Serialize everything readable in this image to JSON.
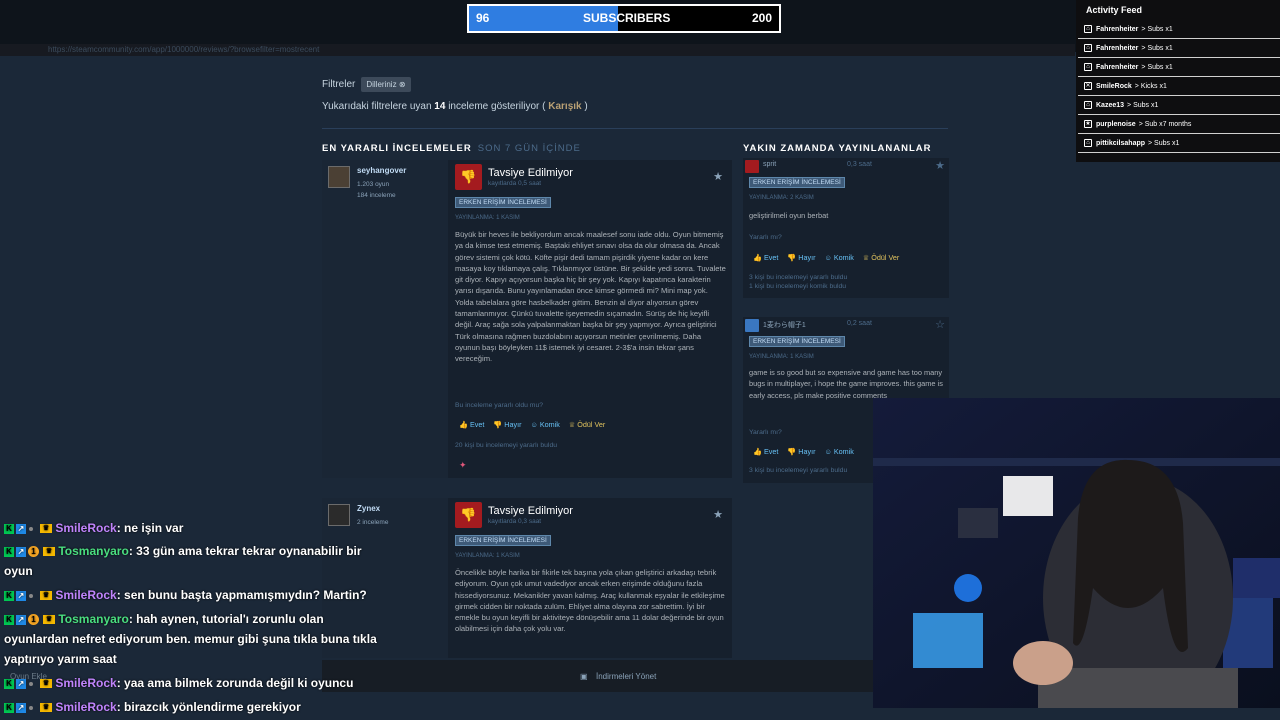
{
  "browser": {
    "url": "https://steamcommunity.com/app/1000000/reviews/?browsefilter=mostrecent"
  },
  "subscriber_bar": {
    "current": "96",
    "label": "SUBSCRIBERS",
    "goal": "200",
    "progress": 0.48
  },
  "activity_feed": {
    "title": "Activity Feed",
    "items": [
      {
        "user": "Fahrenheiter",
        "action": "> Subs x1",
        "icon": "sub-icon"
      },
      {
        "user": "Fahrenheiter",
        "action": "> Subs x1",
        "icon": "sub-icon"
      },
      {
        "user": "Fahrenheiter",
        "action": "> Subs x1",
        "icon": "sub-icon"
      },
      {
        "user": "SmileRock",
        "action": "> Kicks x1",
        "icon": "kick-icon"
      },
      {
        "user": "Kazee13",
        "action": "> Subs x1",
        "icon": "sub-icon"
      },
      {
        "user": "purplenoise",
        "action": "> Sub x7 months",
        "icon": "star-icon"
      },
      {
        "user": "pittikcilsahapp",
        "action": "> Subs x1",
        "icon": "sub-icon"
      }
    ]
  },
  "filters": {
    "label": "Filtreler",
    "chip": "Dilleriniz",
    "summary_prefix": "Yukarıdaki filtrelere uyan",
    "summary_count": "14",
    "summary_suffix": "inceleme gösteriliyor (",
    "summary_mixed": "Karışık",
    "summary_close": ")"
  },
  "sections": {
    "most_helpful": "EN YARARLI İNCELEMELER",
    "period": "SON 7 GÜN İÇİNDE",
    "recent": "YAKIN ZAMANDA YAYINLANANLAR"
  },
  "reviews": [
    {
      "user": "seyhangover",
      "games": "1.203 oyun",
      "reviews_count": "184 inceleme",
      "verdict": "Tavsiye Edilmiyor",
      "playtime": "kayıtlarda 0,5 saat",
      "badge": "ERKEN ERİŞİM İNCELEMESİ",
      "posted": "YAYINLANMA: 1 KASIM",
      "text": "Büyük bir heves ile bekliyordum ancak maalesef sonu iade oldu. Oyun bitmemiş ya da kimse test etmemiş. Baştaki ehliyet sınavı olsa da olur olmasa da. Ancak görev sistemi çok kötü. Köfte pişir dedi tamam pişirdik yiyene kadar on kere masaya koy tıklamaya çalış. Tıklanmıyor üstüne. Bir şekilde yedi sonra. Tuvalete git diyor. Kapıyı açıyorsun başka hiç bir şey yok. Kapıyı kapatınca karakterin yarısı dışarıda. Bunu yayınlamadan önce kimse görmedi mi? Mini map yok. Yolda tabelalara göre hasbelkader gittim. Benzin al diyor alıyorsun görev tamamlanmıyor. Çünkü tuvalette işeyemedin sıçamadın. Sürüş de hiç keyifli değil. Araç sağa sola yalpalanmaktan başka bir şey yapmıyor. Ayrıca geliştirici Türk olmasına rağmen buzdolabını açıyorsun metinler çevrilmemiş. Daha oyunun başı böyleyken 11$ istemek iyi cesaret. 2-3$'a insin tekrar şans vereceğim.",
      "helpful_q": "Bu inceleme yararlı oldu mu?",
      "yes": "Evet",
      "no": "Hayır",
      "funny": "Komik",
      "award": "Ödül Ver",
      "helpful_count": "20 kişi bu incelemeyi yararlı buldu"
    },
    {
      "user": "Zynex",
      "games": "",
      "reviews_count": "2 inceleme",
      "verdict": "Tavsiye Edilmiyor",
      "playtime": "kayıtlarda 0,3 saat",
      "badge": "ERKEN ERİŞİM İNCELEMESİ",
      "posted": "YAYINLANMA: 1 KASIM",
      "text": "Öncelikle böyle harika bir fikirle tek başına yola çıkan geliştirici arkadaşı tebrik ediyorum. Oyun çok umut vadediyor ancak erken erişimde olduğunu fazla hissediyorsunuz. Mekanikler yavan kalmış. Araç kullanmak eşyalar ile etkileşime girmek cidden bir noktada zulüm. Ehliyet alma olayına zor sabrettim. İyi bir emekle bu oyun keyifli bir aktiviteye dönüşebilir ama 11 dolar değerinde bir oyun olabilmesi için daha çok yolu var."
    }
  ],
  "recent": [
    {
      "user": "sprit",
      "time": "0,3 saat",
      "badge": "ERKEN ERİŞİM İNCELEMESİ",
      "posted": "YAYINLANMA: 2 KASIM",
      "text": "geliştirilmeli oyun berbat",
      "helpful_q": "Yararlı mı?",
      "yes": "Evet",
      "no": "Hayır",
      "funny": "Komik",
      "award": "Ödül Ver",
      "helpful_count": "3 kişi bu incelemeyi yararlı buldu",
      "funny_count": "1 kişi bu incelemeyi komik buldu",
      "color": "#a41b1f"
    },
    {
      "user": "1麦わら帽子1",
      "time": "0,2 saat",
      "badge": "ERKEN ERİŞİM İNCELEMESİ",
      "posted": "YAYINLANMA: 1 KASIM",
      "text": "game is so good but so expensive and game has too many bugs in multiplayer, i hope the game improves. this game is early access, pls make positive comments",
      "helpful_q": "Yararlı mı?",
      "yes": "Evet",
      "no": "Hayır",
      "funny": "Komik",
      "helpful_count": "3 kişi bu incelemeyi yararlı buldu",
      "color": "#3a77c0"
    }
  ],
  "bottom": {
    "manage_downloads": "İndirmeleri Yönet",
    "games_list": "Oyun Ekle"
  },
  "chat": [
    {
      "user": "SmileRock",
      "msg": ": ne işin var",
      "color": "purple",
      "badges": "kb-c"
    },
    {
      "user": "Tosmanyaro",
      "msg": ": 33 gün ama tekrar tekrar oynanabilir bir",
      "cont": "oyun",
      "color": "green",
      "badges": "kb1c"
    },
    {
      "user": "SmileRock",
      "msg": ": sen bunu başta yapmamışmıydın? Martin?",
      "color": "purple",
      "badges": "kb-c"
    },
    {
      "user": "Tosmanyaro",
      "msg": ": hah aynen, tutorial'ı zorunlu olan",
      "cont": "oyunlardan nefret ediyorum ben. memur gibi şuna tıkla buna tıkla",
      "cont2": "yaptırıyo yarım saat",
      "color": "green",
      "badges": "kb1c"
    },
    {
      "user": "SmileRock",
      "msg": ": yaa ama bilmek zorunda değil ki oyuncu",
      "color": "purple",
      "badges": "kb-c"
    },
    {
      "user": "SmileRock",
      "msg": ": birazcık yönlendirme gerekiyor",
      "color": "purple",
      "badges": "kb-c"
    }
  ]
}
